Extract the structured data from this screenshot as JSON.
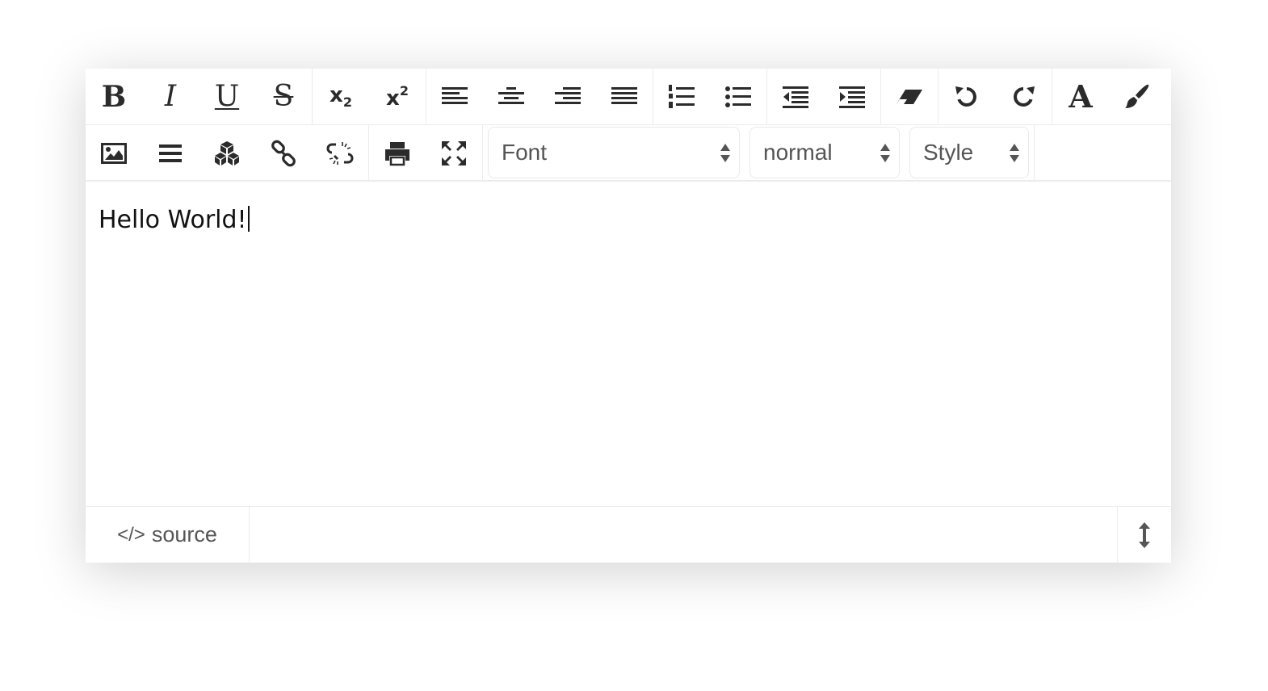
{
  "toolbar": {
    "bold_glyph": "B",
    "italic_glyph": "I",
    "underline_glyph": "U",
    "strike_glyph": "S",
    "subscript_base": "x",
    "subscript_num": "2",
    "superscript_base": "x",
    "superscript_num": "2",
    "text_color_glyph": "A",
    "icons": [
      "bold-icon",
      "italic-icon",
      "underline-icon",
      "strikethrough-icon",
      "subscript-icon",
      "superscript-icon",
      "align-left-icon",
      "align-center-icon",
      "align-right-icon",
      "align-justify-icon",
      "ordered-list-icon",
      "unordered-list-icon",
      "outdent-icon",
      "indent-icon",
      "eraser-icon",
      "undo-icon",
      "redo-icon",
      "text-color-icon",
      "background-color-icon",
      "image-icon",
      "horizontal-rule-icon",
      "cubes-icon",
      "link-icon",
      "unlink-icon",
      "print-icon",
      "fullscreen-icon"
    ]
  },
  "selects": {
    "font": "Font",
    "size": "normal",
    "style": "Style"
  },
  "content": {
    "text": "Hello World!"
  },
  "statusbar": {
    "source_icon": "</>",
    "source_label": "source"
  }
}
